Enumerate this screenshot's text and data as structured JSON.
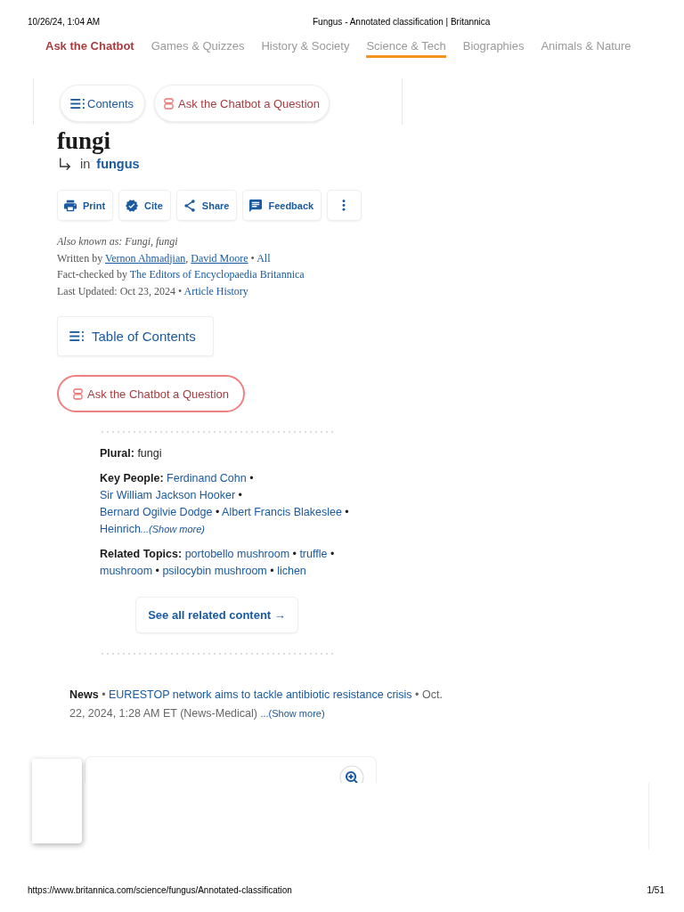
{
  "print_header": {
    "date": "10/26/24, 1:04 AM",
    "title": "Fungus - Annotated classification | Britannica"
  },
  "nav": [
    {
      "label": "Ask the Chatbot",
      "kind": "chatbot",
      "selected": false
    },
    {
      "label": "Games & Quizzes",
      "kind": "category",
      "selected": false
    },
    {
      "label": "History & Society",
      "kind": "category",
      "selected": false
    },
    {
      "label": "Science & Tech",
      "kind": "category",
      "selected": true
    },
    {
      "label": "Biographies",
      "kind": "category",
      "selected": false
    },
    {
      "label": "Animals & Nature",
      "kind": "category",
      "selected": false
    }
  ],
  "sticky_bar": [
    {
      "label": "Contents",
      "kind": "contents"
    },
    {
      "label": "Ask the Chatbot a Question",
      "kind": "chatbot"
    }
  ],
  "article": {
    "title": "fungi",
    "parent": {
      "prefix": "in",
      "link": "fungus"
    }
  },
  "toolbar": [
    {
      "label": "Print",
      "kind": "print"
    },
    {
      "label": "Cite",
      "kind": "cite"
    },
    {
      "label": "Share",
      "kind": "share"
    },
    {
      "label": "Feedback",
      "kind": "feedback"
    },
    {
      "kind": "more"
    }
  ],
  "meta": {
    "also_known_as": "Also known as: Fungi, fungi",
    "written_by": {
      "label": "Written by",
      "authors": [
        "Vernon Ahmadjian",
        "David Moore"
      ],
      "author_separator": ",",
      "separator": "•",
      "all": "All"
    },
    "fact_checked": {
      "label": "Fact-checked by",
      "by": "The Editors of Encyclopaedia Britannica"
    },
    "updated": {
      "label": "Last Updated: Oct 23, 2024",
      "separator": "•",
      "link": "Article History"
    }
  },
  "table_of_contents": {
    "label": "Table of Contents"
  },
  "chatbot_button": {
    "label": "Ask the Chatbot a Question"
  },
  "facts": [
    {
      "label": "Plural:",
      "kind": "text",
      "text": "fungi"
    },
    {
      "label": "Key People:",
      "kind": "links",
      "links": [
        "Ferdinand Cohn",
        "Sir William Jackson Hooker",
        "Bernard Ogilvie Dodge",
        "Albert Francis Blakeslee",
        "Heinrich"
      ],
      "separator": "•",
      "show_more": "...(Show more)"
    },
    {
      "label": "Related Topics:",
      "kind": "links",
      "links": [
        "portobello mushroom",
        "truffle",
        "mushroom",
        "psilocybin mushroom",
        "lichen"
      ],
      "separator": "•"
    }
  ],
  "related_button": {
    "label": "See all related content →"
  },
  "news": {
    "label": "News",
    "separator": "•",
    "headline": "EURESTOP network aims to tackle antibiotic resistance crisis",
    "details": "• Oct. 22, 2024, 1:28 AM ET (News-Medical)",
    "show_more": "...(Show more)"
  },
  "footer": {
    "url": "https://www.britannica.com/science/fungus/Annotated-classification",
    "page": "1/51"
  }
}
